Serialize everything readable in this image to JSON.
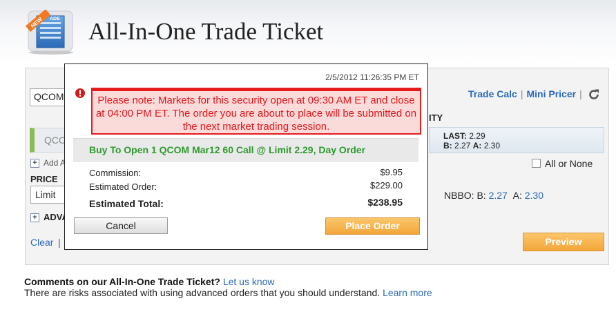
{
  "header": {
    "title": "All-In-One Trade Ticket",
    "icon_badge": "NEW",
    "icon_text": "ADE"
  },
  "ticket": {
    "symbol_value": "QCOM",
    "option_row_text": "QCC",
    "add_label": "Add A",
    "price_label": "PRICE",
    "price_type": "Limit",
    "advanced_label": "ADVA",
    "clear_link": "Clear",
    "clear_sep": "|",
    "tools": {
      "trade_calc": "Trade Calc",
      "separator": "|",
      "mini_pricer": "Mini Pricer",
      "separator2": "|"
    },
    "quantity_label": "ITY",
    "quote": {
      "last_label": "LAST:",
      "last": "2.29",
      "bid_label": "B:",
      "bid": "2.27",
      "ask_label": "A:",
      "ask": "2.30"
    },
    "all_or_none": "All or None",
    "nbbo": {
      "label": "NBBO:",
      "bid_label": "B:",
      "bid": "2.27",
      "ask_label": "A:",
      "ask": "2.30"
    },
    "preview_button": "Preview"
  },
  "modal": {
    "timestamp": "2/5/2012 11:26:35 PM ET",
    "warning_text": "Please note: Markets for this security open at 09:30 AM ET and close at 04:00 PM ET. The order you are about to place will be submitted on the next market trading session.",
    "order_summary": "Buy To Open 1 QCOM Mar12 60 Call @ Limit 2.29, Day Order",
    "commission_label": "Commission:",
    "commission_value": "$9.95",
    "estimated_order_label": "Estimated Order:",
    "estimated_order_value": "$229.00",
    "estimated_total_label": "Estimated Total:",
    "estimated_total_value": "$238.95",
    "cancel_button": "Cancel",
    "place_order_button": "Place Order"
  },
  "footer": {
    "comments_prefix": "Comments on our All-In-One Trade Ticket?",
    "comments_link": "Let us know",
    "risk_text": "There are risks associated with using advanced orders that you should understand.",
    "risk_link": "Learn more"
  },
  "colors": {
    "link": "#2a6ab8",
    "warning_red": "#e3161a",
    "order_green": "#2c9a2c",
    "action_orange": "#f3a63a"
  },
  "icons": [
    "new-trade-icon",
    "alert-icon",
    "refresh-icon",
    "plus-icon",
    "checkbox-icon"
  ]
}
